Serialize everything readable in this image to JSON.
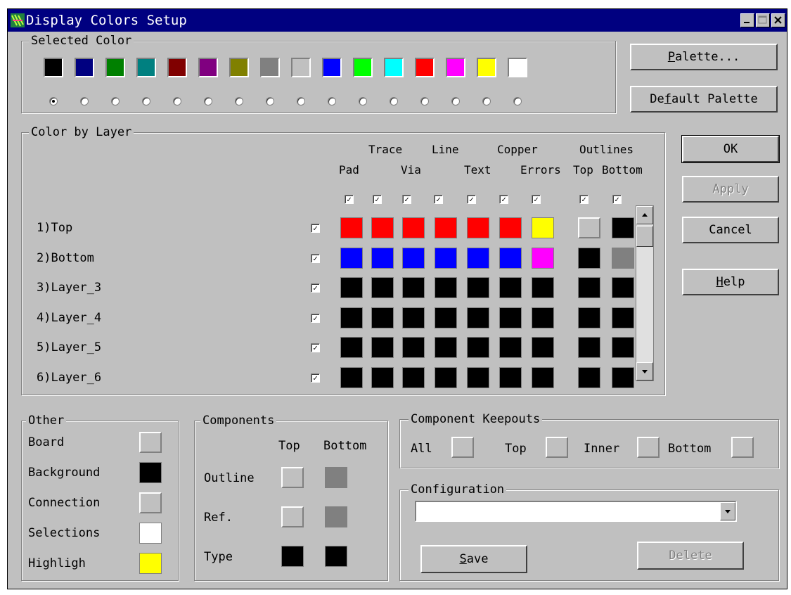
{
  "window": {
    "title": "Display Colors Setup"
  },
  "selected_color": {
    "label": "Selected Color",
    "colors": [
      "#000000",
      "#000080",
      "#008000",
      "#008080",
      "#800000",
      "#800080",
      "#808000",
      "#808080",
      "#c0c0c0",
      "#0000ff",
      "#00ff00",
      "#00ffff",
      "#ff0000",
      "#ff00ff",
      "#ffff00",
      "#ffffff"
    ],
    "selected_index": 0
  },
  "buttons": {
    "palette": {
      "pre": "",
      "u": "P",
      "post": "alette..."
    },
    "default_palette": {
      "pre": "De",
      "u": "f",
      "post": "ault Palette"
    },
    "ok": "OK",
    "apply": "Apply",
    "cancel": "Cancel",
    "help": {
      "pre": "",
      "u": "H",
      "post": "elp"
    },
    "save": {
      "pre": "",
      "u": "S",
      "post": "ave"
    },
    "delete": "Delete"
  },
  "color_by_layer": {
    "label": "Color by Layer",
    "header_top": [
      "Trace",
      "Line",
      "Copper",
      "Outlines"
    ],
    "header_bottom": [
      "Pad",
      "Via",
      "Text",
      "Errors",
      "Top",
      "Bottom"
    ],
    "layers": [
      {
        "label": "1)Top",
        "enabled": true,
        "colors": [
          "#ff0000",
          "#ff0000",
          "#ff0000",
          "#ff0000",
          "#ff0000",
          "#ff0000",
          "#ffff00"
        ],
        "outlines": [
          "#c0c0c0",
          "#000000"
        ]
      },
      {
        "label": "2)Bottom",
        "enabled": true,
        "colors": [
          "#0000ff",
          "#0000ff",
          "#0000ff",
          "#0000ff",
          "#0000ff",
          "#0000ff",
          "#ff00ff"
        ],
        "outlines": [
          "#000000",
          "#808080"
        ]
      },
      {
        "label": "3)Layer_3",
        "enabled": true,
        "colors": [
          "#000000",
          "#000000",
          "#000000",
          "#000000",
          "#000000",
          "#000000",
          "#000000"
        ],
        "outlines": [
          "#000000",
          "#000000"
        ]
      },
      {
        "label": "4)Layer_4",
        "enabled": true,
        "colors": [
          "#000000",
          "#000000",
          "#000000",
          "#000000",
          "#000000",
          "#000000",
          "#000000"
        ],
        "outlines": [
          "#000000",
          "#000000"
        ]
      },
      {
        "label": "5)Layer_5",
        "enabled": true,
        "colors": [
          "#000000",
          "#000000",
          "#000000",
          "#000000",
          "#000000",
          "#000000",
          "#000000"
        ],
        "outlines": [
          "#000000",
          "#000000"
        ]
      },
      {
        "label": "6)Layer_6",
        "enabled": true,
        "colors": [
          "#000000",
          "#000000",
          "#000000",
          "#000000",
          "#000000",
          "#000000",
          "#000000"
        ],
        "outlines": [
          "#000000",
          "#000000"
        ]
      }
    ]
  },
  "other": {
    "label": "Other",
    "items": [
      {
        "label": "Board",
        "color": "#c0c0c0"
      },
      {
        "label": "Background",
        "color": "#000000"
      },
      {
        "label": "Connection",
        "color": "#c0c0c0"
      },
      {
        "label": "Selections",
        "color": "#ffffff"
      },
      {
        "label": "Highligh",
        "color": "#ffff00"
      }
    ]
  },
  "components": {
    "label": "Components",
    "col_top": "Top",
    "col_bottom": "Bottom",
    "rows": [
      {
        "label": "Outline",
        "top": "#c0c0c0",
        "bottom": "#808080"
      },
      {
        "label": "Ref.",
        "top": "#c0c0c0",
        "bottom": "#808080"
      },
      {
        "label": "Type",
        "top": "#000000",
        "bottom": "#000000"
      }
    ]
  },
  "keepouts": {
    "label": "Component Keepouts",
    "items": [
      {
        "label": "All",
        "color": "#c0c0c0"
      },
      {
        "label": "Top",
        "color": "#c0c0c0"
      },
      {
        "label": "Inner",
        "color": "#c0c0c0"
      },
      {
        "label": "Bottom",
        "color": "#c0c0c0"
      }
    ]
  },
  "configuration": {
    "label": "Configuration",
    "value": ""
  }
}
